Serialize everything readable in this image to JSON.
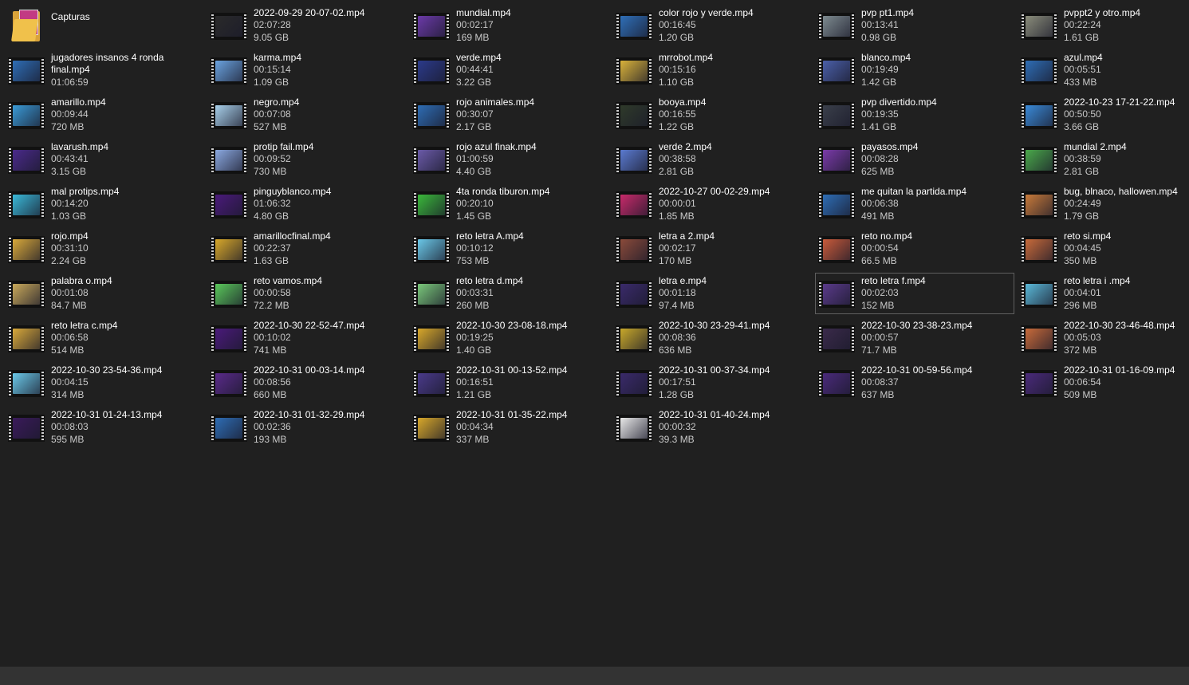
{
  "folder": {
    "name": "Capturas",
    "icon": "folder-icon",
    "colors": {
      "folder": "#f0c14b",
      "paper": "#c23a83"
    }
  },
  "selected_index": 39,
  "files": [
    {
      "name": "2022-09-29 20-07-02.mp4",
      "duration": "02:07:28",
      "size": "9.05 GB",
      "thumb": "#2a2a2a"
    },
    {
      "name": "mundial.mp4",
      "duration": "00:02:17",
      "size": "169 MB",
      "thumb": "#6b3aa8"
    },
    {
      "name": "color rojo y verde.mp4",
      "duration": "00:16:45",
      "size": "1.20 GB",
      "thumb": "#2f6fb8"
    },
    {
      "name": "pvp pt1.mp4",
      "duration": "00:13:41",
      "size": "0.98 GB",
      "thumb": "#7d8a8f"
    },
    {
      "name": "pvppt2 y otro.mp4",
      "duration": "00:22:24",
      "size": "1.61 GB",
      "thumb": "#8a8c7a"
    },
    {
      "name": "jugadores insanos 4 ronda final.mp4",
      "duration": "01:06:59",
      "size": "",
      "thumb": "#2e6db5"
    },
    {
      "name": "karma.mp4",
      "duration": "00:15:14",
      "size": "1.09 GB",
      "thumb": "#6aa3e0"
    },
    {
      "name": "verde.mp4",
      "duration": "00:44:41",
      "size": "3.22 GB",
      "thumb": "#2b3a8a"
    },
    {
      "name": "mrrobot.mp4",
      "duration": "00:15:16",
      "size": "1.10 GB",
      "thumb": "#d9b23a"
    },
    {
      "name": "blanco.mp4",
      "duration": "00:19:49",
      "size": "1.42 GB",
      "thumb": "#4a5fa8"
    },
    {
      "name": "azul.mp4",
      "duration": "00:05:51",
      "size": "433 MB",
      "thumb": "#2e6db5"
    },
    {
      "name": "amarillo.mp4",
      "duration": "00:09:44",
      "size": "720 MB",
      "thumb": "#3a9ad6"
    },
    {
      "name": "negro.mp4",
      "duration": "00:07:08",
      "size": "527 MB",
      "thumb": "#a8d0ea"
    },
    {
      "name": "rojo animales.mp4",
      "duration": "00:30:07",
      "size": "2.17 GB",
      "thumb": "#2e6db5"
    },
    {
      "name": "booya.mp4",
      "duration": "00:16:55",
      "size": "1.22 GB",
      "thumb": "#2f3a2a"
    },
    {
      "name": "pvp divertido.mp4",
      "duration": "00:19:35",
      "size": "1.41 GB",
      "thumb": "#3a3f4a"
    },
    {
      "name": "2022-10-23 17-21-22.mp4",
      "duration": "00:50:50",
      "size": "3.66 GB",
      "thumb": "#3a8ad8"
    },
    {
      "name": "lavarush.mp4",
      "duration": "00:43:41",
      "size": "3.15 GB",
      "thumb": "#4a2a8a"
    },
    {
      "name": "protip fail.mp4",
      "duration": "00:09:52",
      "size": "730 MB",
      "thumb": "#8aa8e0"
    },
    {
      "name": "rojo azul finak.mp4",
      "duration": "01:00:59",
      "size": "4.40 GB",
      "thumb": "#6a5aa8"
    },
    {
      "name": "verde 2.mp4",
      "duration": "00:38:58",
      "size": "2.81 GB",
      "thumb": "#5a7ad0"
    },
    {
      "name": "payasos.mp4",
      "duration": "00:08:28",
      "size": "625 MB",
      "thumb": "#7a3aa8"
    },
    {
      "name": "mundial 2.mp4",
      "duration": "00:38:59",
      "size": "2.81 GB",
      "thumb": "#4aa84a"
    },
    {
      "name": "mal protips.mp4",
      "duration": "00:14:20",
      "size": "1.03 GB",
      "thumb": "#3ab8d8"
    },
    {
      "name": "pinguyblanco.mp4",
      "duration": "01:06:32",
      "size": "4.80 GB",
      "thumb": "#4a1a7a"
    },
    {
      "name": "4ta ronda tiburon.mp4",
      "duration": "00:20:10",
      "size": "1.45 GB",
      "thumb": "#3ab83a"
    },
    {
      "name": "2022-10-27 00-02-29.mp4",
      "duration": "00:00:01",
      "size": "1.85 MB",
      "thumb": "#c82a6a"
    },
    {
      "name": "me quitan la partida.mp4",
      "duration": "00:06:38",
      "size": "491 MB",
      "thumb": "#2e6db5"
    },
    {
      "name": "bug, blnaco, hallowen.mp4",
      "duration": "00:24:49",
      "size": "1.79 GB",
      "thumb": "#c87a3a"
    },
    {
      "name": "rojo.mp4",
      "duration": "00:31:10",
      "size": "2.24 GB",
      "thumb": "#d8a83a"
    },
    {
      "name": "amarillocfinal.mp4",
      "duration": "00:22:37",
      "size": "1.63 GB",
      "thumb": "#d8a82a"
    },
    {
      "name": "reto letra A.mp4",
      "duration": "00:10:12",
      "size": "753 MB",
      "thumb": "#6ac8e8"
    },
    {
      "name": "letra a 2.mp4",
      "duration": "00:02:17",
      "size": "170 MB",
      "thumb": "#8a4a3a"
    },
    {
      "name": "reto no.mp4",
      "duration": "00:00:54",
      "size": "66.5 MB",
      "thumb": "#c85a3a"
    },
    {
      "name": "reto si.mp4",
      "duration": "00:04:45",
      "size": "350 MB",
      "thumb": "#c86a3a"
    },
    {
      "name": "palabra o.mp4",
      "duration": "00:01:08",
      "size": "84.7 MB",
      "thumb": "#c8a85a"
    },
    {
      "name": "reto vamos.mp4",
      "duration": "00:00:58",
      "size": "72.2 MB",
      "thumb": "#5ac85a"
    },
    {
      "name": "reto letra d.mp4",
      "duration": "00:03:31",
      "size": "260 MB",
      "thumb": "#7ac87a"
    },
    {
      "name": "letra e.mp4",
      "duration": "00:01:18",
      "size": "97.4 MB",
      "thumb": "#3a2a6a"
    },
    {
      "name": "reto letra f.mp4",
      "duration": "00:02:03",
      "size": "152 MB",
      "thumb": "#5a3a8a"
    },
    {
      "name": "reto letra i .mp4",
      "duration": "00:04:01",
      "size": "296 MB",
      "thumb": "#5ab8d8"
    },
    {
      "name": "reto letra c.mp4",
      "duration": "00:06:58",
      "size": "514 MB",
      "thumb": "#d8a83a"
    },
    {
      "name": "2022-10-30 22-52-47.mp4",
      "duration": "00:10:02",
      "size": "741 MB",
      "thumb": "#4a1a7a"
    },
    {
      "name": "2022-10-30 23-08-18.mp4",
      "duration": "00:19:25",
      "size": "1.40 GB",
      "thumb": "#d8a82a"
    },
    {
      "name": "2022-10-30 23-29-41.mp4",
      "duration": "00:08:36",
      "size": "636 MB",
      "thumb": "#c8a82a"
    },
    {
      "name": "2022-10-30 23-38-23.mp4",
      "duration": "00:00:57",
      "size": "71.7 MB",
      "thumb": "#3a2a4a"
    },
    {
      "name": "2022-10-30 23-46-48.mp4",
      "duration": "00:05:03",
      "size": "372 MB",
      "thumb": "#c86a3a"
    },
    {
      "name": "2022-10-30 23-54-36.mp4",
      "duration": "00:04:15",
      "size": "314 MB",
      "thumb": "#6ac8e8"
    },
    {
      "name": "2022-10-31 00-03-14.mp4",
      "duration": "00:08:56",
      "size": "660 MB",
      "thumb": "#5a2a8a"
    },
    {
      "name": "2022-10-31 00-13-52.mp4",
      "duration": "00:16:51",
      "size": "1.21 GB",
      "thumb": "#4a3a8a"
    },
    {
      "name": "2022-10-31 00-37-34.mp4",
      "duration": "00:17:51",
      "size": "1.28 GB",
      "thumb": "#3a2a6a"
    },
    {
      "name": "2022-10-31 00-59-56.mp4",
      "duration": "00:08:37",
      "size": "637 MB",
      "thumb": "#4a2a7a"
    },
    {
      "name": "2022-10-31 01-16-09.mp4",
      "duration": "00:06:54",
      "size": "509 MB",
      "thumb": "#4a2a7a"
    },
    {
      "name": "2022-10-31 01-24-13.mp4",
      "duration": "00:08:03",
      "size": "595 MB",
      "thumb": "#3a1a5a"
    },
    {
      "name": "2022-10-31 01-32-29.mp4",
      "duration": "00:02:36",
      "size": "193 MB",
      "thumb": "#2e6db5"
    },
    {
      "name": "2022-10-31 01-35-22.mp4",
      "duration": "00:04:34",
      "size": "337 MB",
      "thumb": "#d8a82a"
    },
    {
      "name": "2022-10-31 01-40-24.mp4",
      "duration": "00:00:32",
      "size": "39.3 MB",
      "thumb": "#e8e8e8"
    }
  ]
}
